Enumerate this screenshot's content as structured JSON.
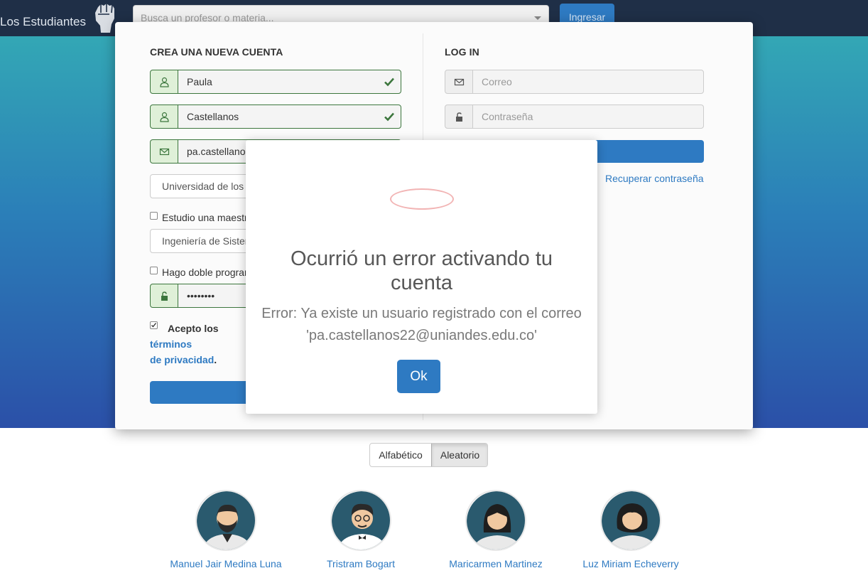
{
  "navbar": {
    "brand": "Los Estudiantes",
    "search_placeholder": "Busca un profesor o materia...",
    "login_button": "Ingresar"
  },
  "register": {
    "title": "CREA UNA NUEVA CUENTA",
    "first_name": "Paula",
    "last_name": "Castellanos",
    "email": "pa.castellanos22@uniandes.edu.co",
    "university": "Universidad de los Andes",
    "masters_label": "Estudio una maestría",
    "program": "Ingeniería de Sistemas",
    "double_program_label": "Hago doble programa",
    "password": "••••••••",
    "terms_prefix": "Acepto los",
    "terms_link_1": "términos",
    "terms_link_2": "de privacidad",
    "terms_end": "."
  },
  "login": {
    "title": "LOG IN",
    "email_placeholder": "Correo",
    "password_placeholder": "Contraseña",
    "recover_link": "Recuperar contraseña"
  },
  "sort": {
    "options": [
      "Alfabético",
      "Aleatorio"
    ],
    "active": "Aleatorio"
  },
  "professors": [
    {
      "name": "Manuel Jair Medina Luna"
    },
    {
      "name": "Tristram Bogart"
    },
    {
      "name": "Maricarmen Martinez"
    },
    {
      "name": "Luz Miriam Echeverry"
    }
  ],
  "modal": {
    "title": "Ocurrió un error activando tu cuenta",
    "message": "Error: Ya existe un usuario registrado con el correo 'pa.castellanos22@uniandes.edu.co'",
    "ok_button": "Ok"
  },
  "colors": {
    "navbar": "#1f2f47",
    "primary": "#2e7ac2",
    "success": "#3c763d",
    "error_ring": "#f2b4b4"
  }
}
